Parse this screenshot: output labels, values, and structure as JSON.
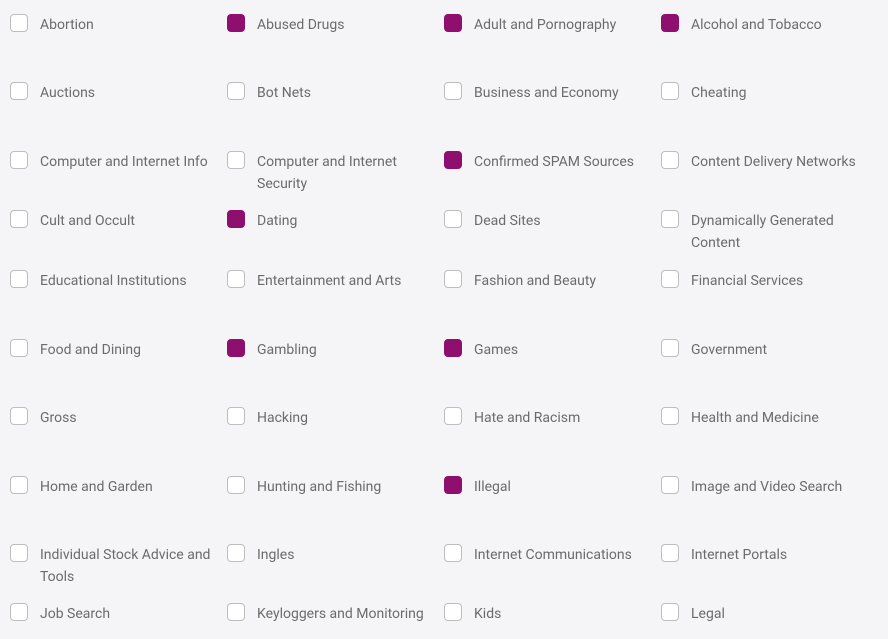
{
  "categories": [
    {
      "id": "abortion",
      "label": "Abortion",
      "checked": false
    },
    {
      "id": "abused-drugs",
      "label": "Abused Drugs",
      "checked": true
    },
    {
      "id": "adult-and-pornography",
      "label": "Adult and Pornography",
      "checked": true
    },
    {
      "id": "alcohol-and-tobacco",
      "label": "Alcohol and Tobacco",
      "checked": true
    },
    {
      "id": "auctions",
      "label": "Auctions",
      "checked": false
    },
    {
      "id": "bot-nets",
      "label": "Bot Nets",
      "checked": false
    },
    {
      "id": "business-and-economy",
      "label": "Business and Economy",
      "checked": false
    },
    {
      "id": "cheating",
      "label": "Cheating",
      "checked": false
    },
    {
      "id": "computer-and-internet-info",
      "label": "Computer and Internet Info",
      "checked": false
    },
    {
      "id": "computer-and-internet-security",
      "label": "Computer and Internet Security",
      "checked": false
    },
    {
      "id": "confirmed-spam-sources",
      "label": "Confirmed SPAM Sources",
      "checked": true
    },
    {
      "id": "content-delivery-networks",
      "label": "Content Delivery Networks",
      "checked": false
    },
    {
      "id": "cult-and-occult",
      "label": "Cult and Occult",
      "checked": false
    },
    {
      "id": "dating",
      "label": "Dating",
      "checked": true
    },
    {
      "id": "dead-sites",
      "label": "Dead Sites",
      "checked": false
    },
    {
      "id": "dynamically-generated-content",
      "label": "Dynamically Generated Content",
      "checked": false
    },
    {
      "id": "educational-institutions",
      "label": "Educational Institutions",
      "checked": false
    },
    {
      "id": "entertainment-and-arts",
      "label": "Entertainment and Arts",
      "checked": false
    },
    {
      "id": "fashion-and-beauty",
      "label": "Fashion and Beauty",
      "checked": false
    },
    {
      "id": "financial-services",
      "label": "Financial Services",
      "checked": false
    },
    {
      "id": "food-and-dining",
      "label": "Food and Dining",
      "checked": false
    },
    {
      "id": "gambling",
      "label": "Gambling",
      "checked": true
    },
    {
      "id": "games",
      "label": "Games",
      "checked": true
    },
    {
      "id": "government",
      "label": "Government",
      "checked": false
    },
    {
      "id": "gross",
      "label": "Gross",
      "checked": false
    },
    {
      "id": "hacking",
      "label": "Hacking",
      "checked": false
    },
    {
      "id": "hate-and-racism",
      "label": "Hate and Racism",
      "checked": false
    },
    {
      "id": "health-and-medicine",
      "label": "Health and Medicine",
      "checked": false
    },
    {
      "id": "home-and-garden",
      "label": "Home and Garden",
      "checked": false
    },
    {
      "id": "hunting-and-fishing",
      "label": "Hunting and Fishing",
      "checked": false
    },
    {
      "id": "illegal",
      "label": "Illegal",
      "checked": true
    },
    {
      "id": "image-and-video-search",
      "label": "Image and Video Search",
      "checked": false
    },
    {
      "id": "individual-stock-advice-and-tools",
      "label": "Individual Stock Advice and Tools",
      "checked": false
    },
    {
      "id": "ingles",
      "label": "Ingles",
      "checked": false
    },
    {
      "id": "internet-communications",
      "label": "Internet Communications",
      "checked": false
    },
    {
      "id": "internet-portals",
      "label": "Internet Portals",
      "checked": false
    },
    {
      "id": "job-search",
      "label": "Job Search",
      "checked": false
    },
    {
      "id": "keyloggers-and-monitoring",
      "label": "Keyloggers and Monitoring",
      "checked": false
    },
    {
      "id": "kids",
      "label": "Kids",
      "checked": false
    },
    {
      "id": "legal",
      "label": "Legal",
      "checked": false
    }
  ],
  "row_gaps": [
    46,
    46,
    14,
    16,
    46,
    46,
    46,
    46,
    14
  ]
}
